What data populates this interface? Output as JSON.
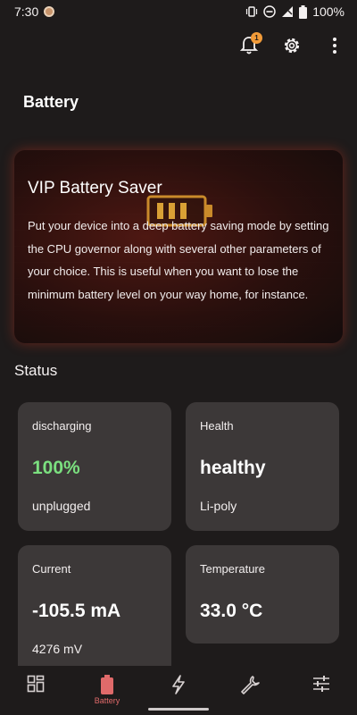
{
  "status_bar": {
    "time": "7:30",
    "battery_percent": "100%"
  },
  "page": {
    "title": "Battery"
  },
  "hero": {
    "title": "VIP Battery Saver",
    "description": "Put your device into a deep battery saving mode by setting the CPU governor along with several other parameters of your choice. This is useful when you want to lose the minimum battery level on your way home, for instance."
  },
  "status_section": {
    "title": "Status"
  },
  "cards": {
    "state": {
      "label": "discharging",
      "value": "100%",
      "sub": "unplugged"
    },
    "health": {
      "label": "Health",
      "value": "healthy",
      "sub": "Li-poly"
    },
    "current": {
      "label": "Current",
      "value": "-105.5 mA",
      "sub": "4276 mV"
    },
    "temperature": {
      "label": "Temperature",
      "value": "33.0 °C"
    }
  },
  "notification_badge": "1",
  "bottom_nav": {
    "active_label": "Battery",
    "items": [
      "dashboard-icon",
      "battery-icon",
      "bolt-icon",
      "wrench-icon",
      "sliders-icon"
    ]
  },
  "colors": {
    "background": "#1e1b1b",
    "card": "#3c3838",
    "accent_red": "#e06a6a",
    "badge": "#f29b39",
    "positive_green": "#7be07f"
  }
}
